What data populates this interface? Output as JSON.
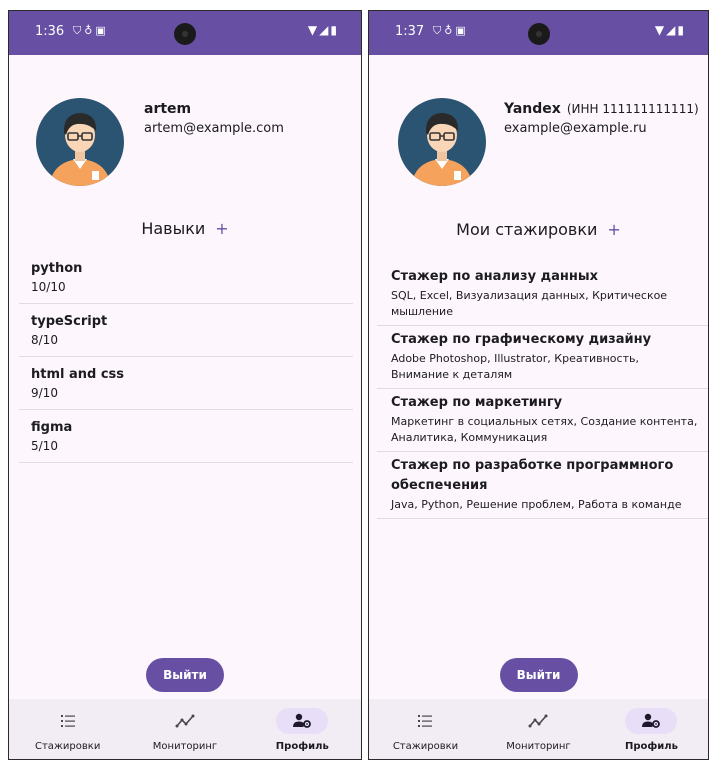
{
  "phones": [
    {
      "status": {
        "time": "1:36"
      },
      "profile": {
        "name": "artem",
        "email": "artem@example.com"
      },
      "section": {
        "title": "Навыки",
        "add": "+"
      },
      "items": [
        {
          "title": "python",
          "sub": "10/10"
        },
        {
          "title": "typeScript",
          "sub": "8/10"
        },
        {
          "title": "html and css",
          "sub": "9/10"
        },
        {
          "title": "figma",
          "sub": "5/10"
        }
      ],
      "logout": "Выйти",
      "nav": [
        "Стажировки",
        "Мониторинг",
        "Профиль"
      ]
    },
    {
      "status": {
        "time": "1:37"
      },
      "profile": {
        "name": "Yandex",
        "inn": "(ИНН 111111111111)",
        "email": "example@example.ru"
      },
      "section": {
        "title": "Мои стажировки",
        "add": "+"
      },
      "items": [
        {
          "title": "Стажер по анализу данных",
          "sub": "SQL, Excel, Визуализация данных, Критическое мышление"
        },
        {
          "title": "Стажер по графическому дизайну",
          "sub": "Adobe Photoshop, Illustrator, Креативность, Внимание к деталям"
        },
        {
          "title": "Стажер по маркетингу",
          "sub": "Маркетинг в социальных сетях, Создание контента, Аналитика, Коммуникация"
        },
        {
          "title": "Стажер по разработке программного обеспечения",
          "sub": "Java, Python, Решение проблем, Работа в команде"
        }
      ],
      "logout": "Выйти",
      "nav": [
        "Стажировки",
        "Мониторинг",
        "Профиль"
      ]
    }
  ],
  "colors": {
    "accent": "#6750a4",
    "background": "#fdf7fd",
    "nav_background": "#f2ecf4",
    "nav_active": "#e8def8"
  },
  "icons": {
    "status": [
      "shield-icon",
      "mic-icon",
      "image-icon",
      "wifi-icon",
      "signal-icon",
      "battery-icon"
    ],
    "nav": [
      "list-icon",
      "trend-icon",
      "profile-settings-icon"
    ]
  }
}
